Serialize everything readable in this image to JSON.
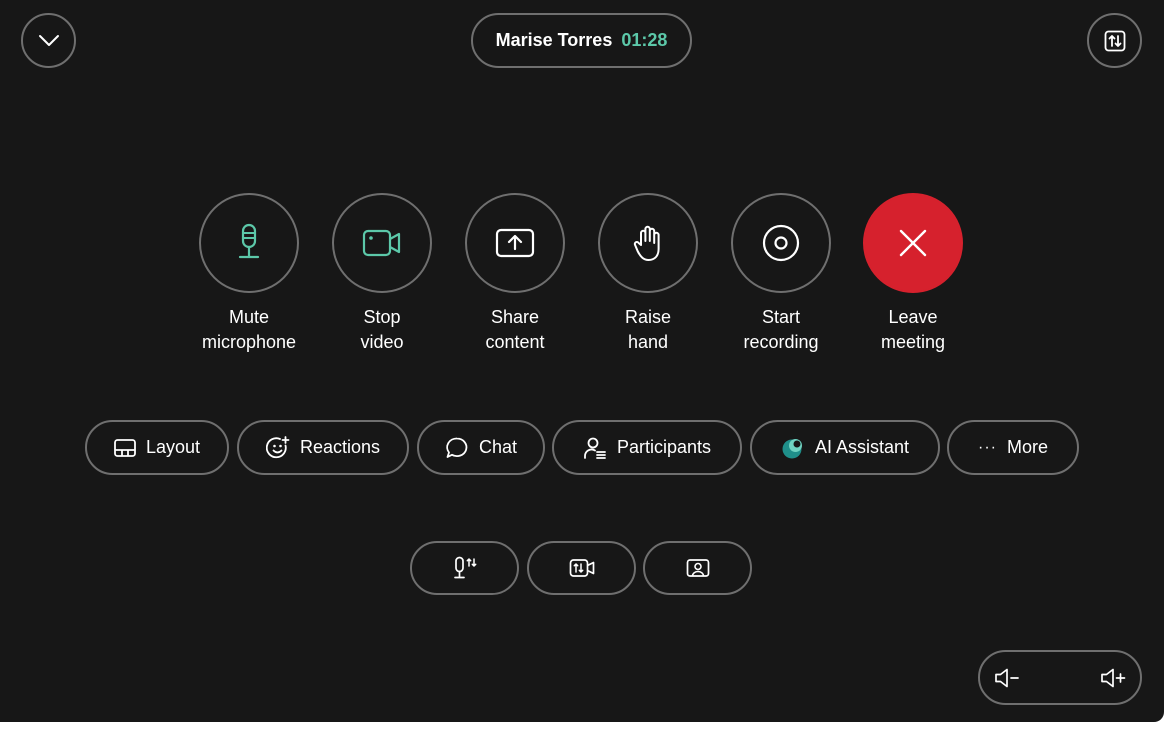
{
  "top": {
    "collapse_icon": "chevron-down-icon",
    "caller_name": "Marise Torres",
    "call_duration": "01:28",
    "swap_icon": "swap-arrows-icon"
  },
  "actions": [
    {
      "line1": "Mute",
      "line2": "microphone",
      "icon": "microphone-icon",
      "color": "#5cc8a9"
    },
    {
      "line1": "Stop",
      "line2": "video",
      "icon": "video-camera-icon",
      "color": "#5cc8a9"
    },
    {
      "line1": "Share",
      "line2": "content",
      "icon": "share-screen-icon",
      "color": "#ffffff"
    },
    {
      "line1": "Raise",
      "line2": "hand",
      "icon": "hand-icon",
      "color": "#ffffff"
    },
    {
      "line1": "Start",
      "line2": "recording",
      "icon": "record-icon",
      "color": "#ffffff"
    },
    {
      "line1": "Leave",
      "line2": "meeting",
      "icon": "close-icon",
      "color": "#d6212d"
    }
  ],
  "menu": [
    {
      "label": "Layout",
      "icon": "layout-icon"
    },
    {
      "label": "Reactions",
      "icon": "emoji-add-icon"
    },
    {
      "label": "Chat",
      "icon": "chat-bubble-icon"
    },
    {
      "label": "Participants",
      "icon": "participants-icon"
    },
    {
      "label": "AI Assistant",
      "icon": "ai-assistant-icon"
    },
    {
      "label": "More",
      "icon": "more-dots-icon",
      "glyph": "···"
    }
  ],
  "small_controls": [
    {
      "icon": "microphone-settings-icon"
    },
    {
      "icon": "camera-settings-icon"
    },
    {
      "icon": "self-view-icon"
    }
  ],
  "volume": {
    "down_icon": "volume-down-icon",
    "up_icon": "volume-up-icon"
  },
  "colors": {
    "background": "#171717",
    "accent": "#5cc8a9",
    "danger": "#d6212d",
    "border": "#6f6f6f"
  }
}
